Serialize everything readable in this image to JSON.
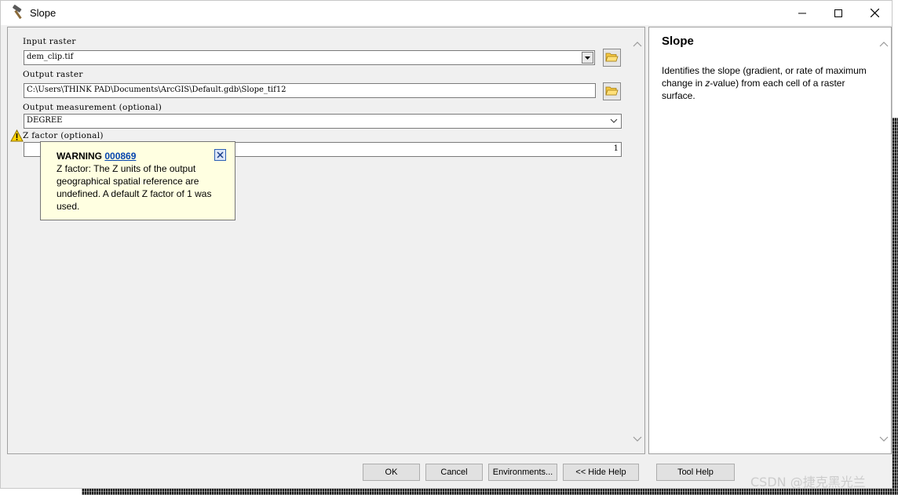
{
  "window": {
    "title": "Slope",
    "icon": "hammer-icon"
  },
  "params": {
    "input_raster": {
      "label": "Input raster",
      "value": "dem_clip.tif"
    },
    "output_raster": {
      "label": "Output raster",
      "value": "C:\\Users\\THINK PAD\\Documents\\ArcGIS\\Default.gdb\\Slope_tif12"
    },
    "output_measurement": {
      "label": "Output measurement (optional)",
      "value": "DEGREE"
    },
    "z_factor": {
      "label": "Z factor (optional)",
      "value": "1"
    }
  },
  "warning": {
    "title": "WARNING",
    "code": "000869",
    "message": "Z factor: The Z units of the output geographical spatial reference are undefined. A default Z factor of 1 was used."
  },
  "help": {
    "title": "Slope",
    "text_before": "Identifies the slope (gradient, or rate of maximum change in ",
    "text_italic": "z",
    "text_after": "-value) from each cell of a raster surface."
  },
  "buttons": {
    "ok": "OK",
    "cancel": "Cancel",
    "environments": "Environments...",
    "hide_help": "<< Hide Help",
    "tool_help": "Tool Help"
  },
  "watermark": "CSDN @捷克黑光兰"
}
